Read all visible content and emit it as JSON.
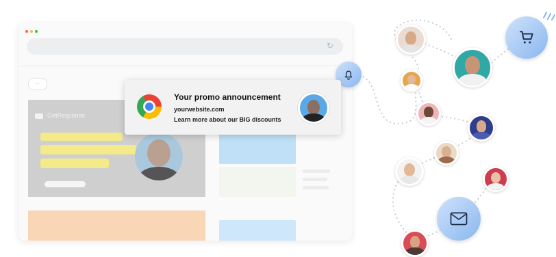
{
  "notification": {
    "title": "Your promo announcement",
    "site": "yourwebsite.com",
    "body": "Learn more about our BIG discounts"
  },
  "browser": {
    "brand": "GetResponse"
  },
  "icons": {
    "bell": "bell-icon",
    "cart": "cart-icon",
    "mail": "mail-icon",
    "chrome": "chrome-logo-icon",
    "reload": "reload-icon",
    "back": "back-arrow-icon"
  },
  "colors": {
    "bubble": "#8ab7f0",
    "hero_bg": "#cfcfcf",
    "highlight": "#f4ea8a",
    "orange_card": "#f9d6b6"
  }
}
